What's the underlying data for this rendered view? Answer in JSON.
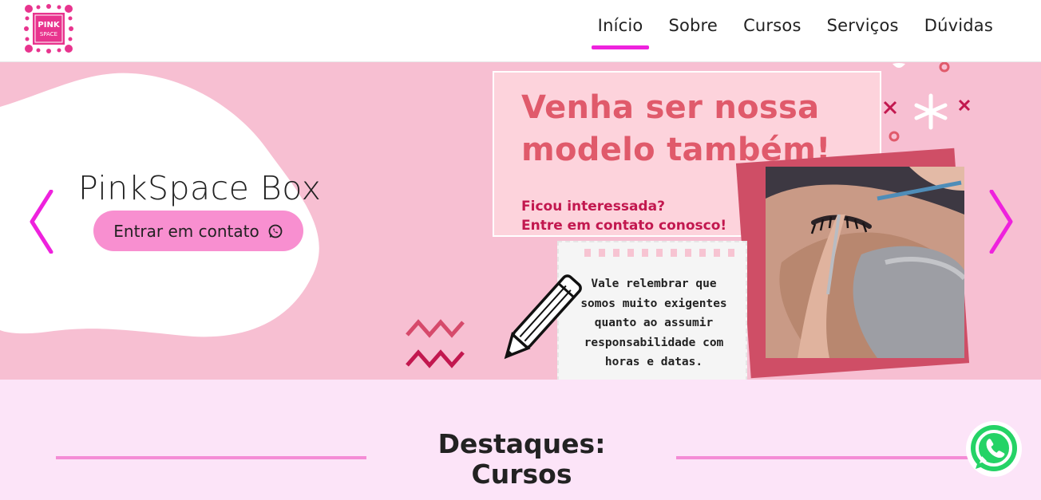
{
  "nav": {
    "logo_text_top": "PINK",
    "logo_text_bottom": "SPACE",
    "items": [
      {
        "label": "Início",
        "active": true
      },
      {
        "label": "Sobre",
        "active": false
      },
      {
        "label": "Cursos",
        "active": false
      },
      {
        "label": "Serviços",
        "active": false
      },
      {
        "label": "Dúvidas",
        "active": false
      }
    ]
  },
  "hero": {
    "title": "PinkSpace Box",
    "cta_label": "Entrar em contato",
    "banner": {
      "headline_line1": "Venha ser nossa",
      "headline_line2": "modelo também!",
      "sub_line1": "Ficou interessada?",
      "sub_line2": "Entre em contato conosco!",
      "note_lines": [
        "Vale relembrar que",
        "somos muito exigentes",
        "quanto ao assumir",
        "responsabilidade com",
        "horas e datas."
      ]
    }
  },
  "section": {
    "title_line1": "Destaques:",
    "title_line2": "Cursos"
  },
  "colors": {
    "accent": "#ee22dd",
    "hero_bg": "#f7bfd2",
    "cta_bg": "#f88fd0",
    "section_bg": "#fce4f8",
    "headline": "#e05a6b",
    "whatsapp": "#25d366"
  }
}
